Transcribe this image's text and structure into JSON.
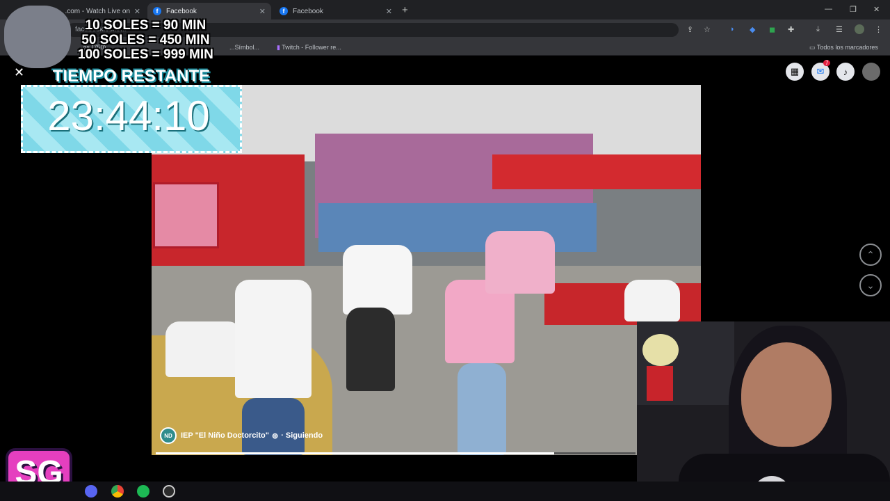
{
  "browser": {
    "tabs": [
      {
        "title": "koalit... .com - Watch Live on ...",
        "icon": "kick-icon",
        "active": false
      },
      {
        "title": "Facebook",
        "icon": "facebook-icon",
        "active": true
      },
      {
        "title": "Facebook",
        "icon": "facebook-icon",
        "active": false
      }
    ],
    "new_tab": "+",
    "address": "facebook.com/...",
    "bookmarks": [
      "...os (750)",
      "...Símbol...",
      "Twitch - Follower re..."
    ],
    "all_bookmarks": "Todos los marcadores",
    "window_controls": [
      "—",
      "❐",
      "✕"
    ]
  },
  "overlay": {
    "prices": [
      "10 SOLES = 90 MIN",
      "50 SOLES = 450 MIN",
      "100 SOLES = 999 MIN"
    ],
    "timer_header": "TIEMPO RESTANTE",
    "timer_value": "23:44:10",
    "close": "✕",
    "logo": "SG"
  },
  "facebook": {
    "notification_count": "7",
    "page_name": "IEP \"El Niño Doctorcito\"",
    "follow_status": "· Siguiendo",
    "logo_initials": "ND",
    "progress": 0.83
  },
  "colors": {
    "accent": "#1877f2",
    "timer_bg": "#7fd8e8",
    "logo_bg": "#e53fbf"
  }
}
